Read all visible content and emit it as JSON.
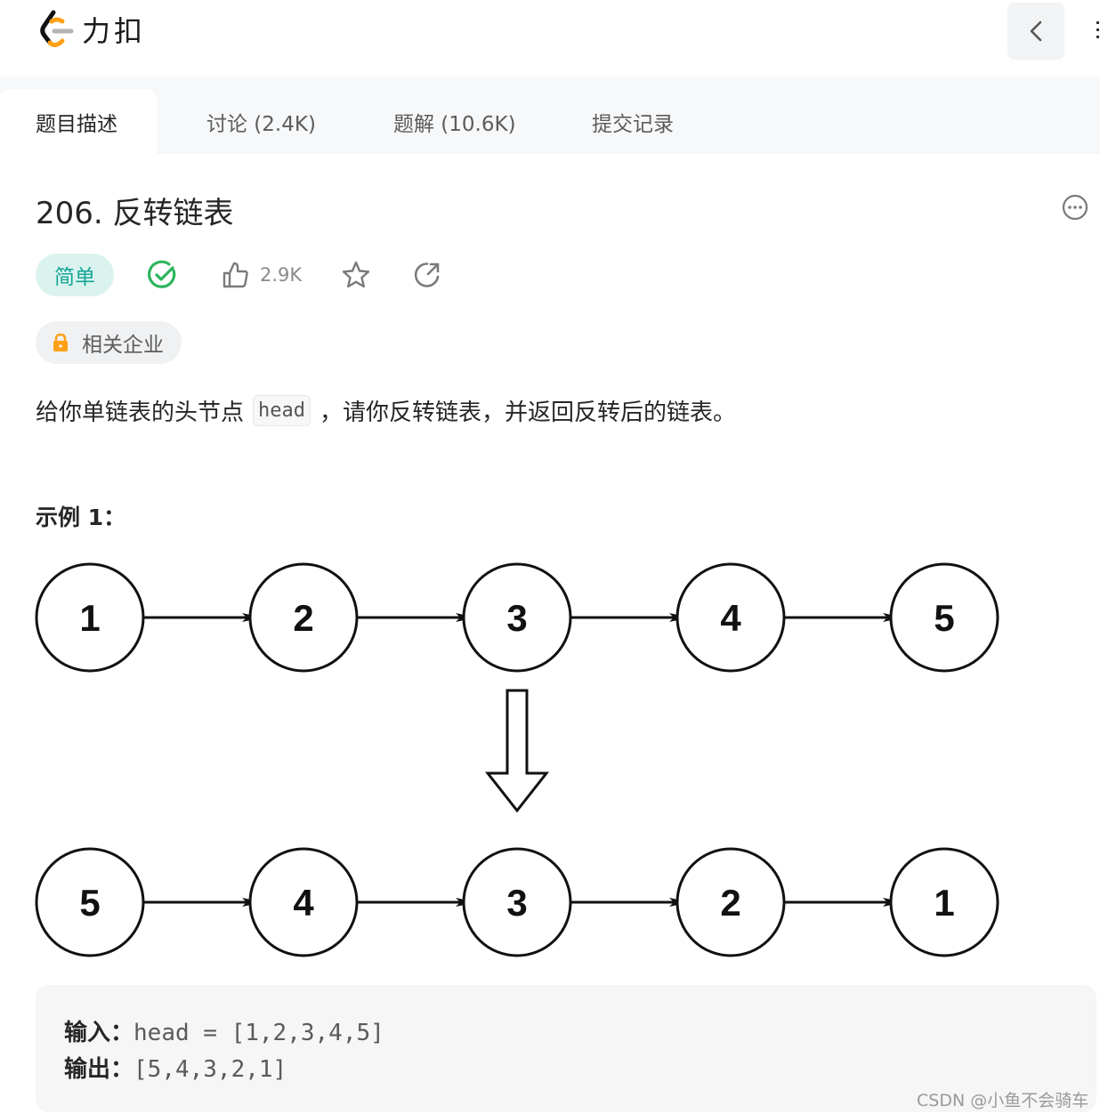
{
  "header": {
    "logo_text": "力扣",
    "back_icon": "chevron-left-icon",
    "overflow_icon": "more-vertical-icon"
  },
  "tabs": [
    {
      "label": "题目描述",
      "active": true
    },
    {
      "label": "讨论 (2.4K)",
      "active": false
    },
    {
      "label": "题解 (10.6K)",
      "active": false
    },
    {
      "label": "提交记录",
      "active": false
    }
  ],
  "problem": {
    "title": "206. 反转链表",
    "difficulty": "简单",
    "solved_icon": "check-circle-icon",
    "likes": "2.9K",
    "favorite_icon": "star-icon",
    "share_icon": "share-icon",
    "more_icon": "more-horizontal-icon",
    "company_tag": "相关企业",
    "description_before": "给你单链表的头节点",
    "description_code": "head",
    "description_after": "，请你反转链表，并返回反转后的链表。"
  },
  "example": {
    "title": "示例 1：",
    "diagram": {
      "before": [
        "1",
        "2",
        "3",
        "4",
        "5"
      ],
      "after": [
        "5",
        "4",
        "3",
        "2",
        "1"
      ]
    },
    "input_label": "输入：",
    "input_value": "head = [1,2,3,4,5]",
    "output_label": "输出：",
    "output_value": "[5,4,3,2,1]"
  },
  "watermark": "CSDN @小鱼不会骑车",
  "colors": {
    "easy_text": "#15a597",
    "easy_bg": "#dbf3ef",
    "solved_green": "#2db55d",
    "lock_orange": "#ffa116"
  }
}
